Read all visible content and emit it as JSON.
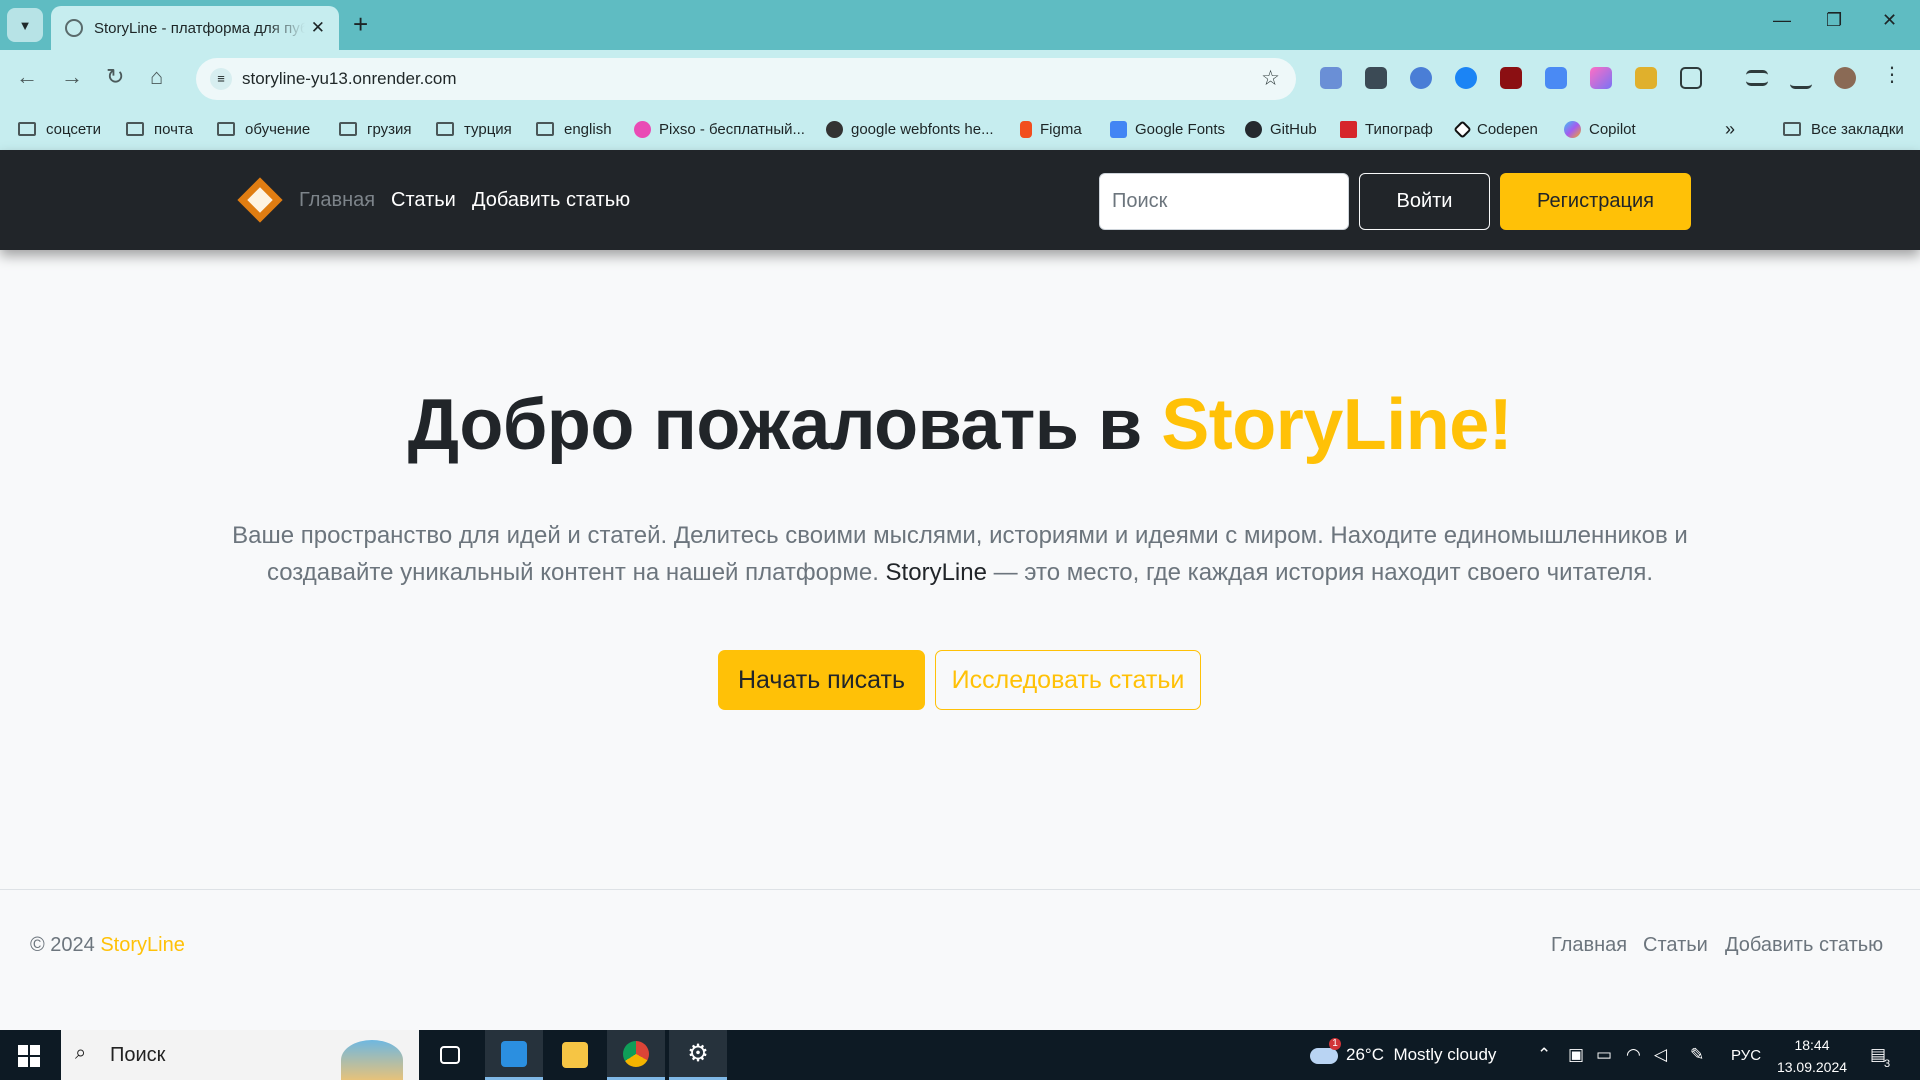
{
  "browser": {
    "tab_title": "StoryLine - платформа для публикации статей",
    "url": "storyline-yu13.onrender.com",
    "bookmarks": [
      {
        "label": "соцсети",
        "type": "folder"
      },
      {
        "label": "почта",
        "type": "folder"
      },
      {
        "label": "обучение",
        "type": "folder"
      },
      {
        "label": "грузия",
        "type": "folder"
      },
      {
        "label": "турция",
        "type": "folder"
      },
      {
        "label": "english",
        "type": "folder"
      },
      {
        "label": "Pixso - бесплатный...",
        "type": "site",
        "color": "#e94bb5"
      },
      {
        "label": "google webfonts he...",
        "type": "site",
        "color": "#333333"
      },
      {
        "label": "Figma",
        "type": "site",
        "color": "#f24e1e"
      },
      {
        "label": "Google Fonts",
        "type": "site",
        "color": "#4285f4"
      },
      {
        "label": "GitHub",
        "type": "site",
        "color": "#24292e"
      },
      {
        "label": "Типограф",
        "type": "site",
        "color": "#d6262b"
      },
      {
        "label": "Codepen",
        "type": "site",
        "color": "#111111"
      },
      {
        "label": "Copilot",
        "type": "site",
        "color": "#7a5cf0"
      }
    ],
    "all_bookmarks": "Все закладки",
    "overflow": "»"
  },
  "site": {
    "nav": {
      "home": "Главная",
      "articles": "Статьи",
      "add_article": "Добавить статью"
    },
    "search_placeholder": "Поиск",
    "login": "Войти",
    "register": "Регистрация",
    "hero": {
      "title_prefix": "Добро пожаловать в ",
      "title_brand": "StoryLine!",
      "text_part1": "Ваше пространство для идей и статей. Делитесь своими мыслями, историями и идеями с миром. Находите единомышленников и создавайте уникальный контент на нашей платформе. ",
      "text_brand": "StoryLine",
      "text_part2": " — это место, где каждая история находит своего читателя.",
      "btn_start": "Начать писать",
      "btn_explore": "Исследовать статьи"
    },
    "footer": {
      "copyright": "© 2024 ",
      "brand": "StoryLine",
      "links": [
        "Главная",
        "Статьи",
        "Добавить статью"
      ]
    },
    "colors": {
      "accent": "#ffc107",
      "header_bg": "#212529",
      "page_bg": "#f8f9fa"
    }
  },
  "taskbar": {
    "search": "Поиск",
    "weather_temp": "26°C",
    "weather_desc": "Mostly cloudy",
    "weather_badge": "1",
    "lang": "РУС",
    "time": "18:44",
    "date": "13.09.2024",
    "notifications": "3"
  }
}
